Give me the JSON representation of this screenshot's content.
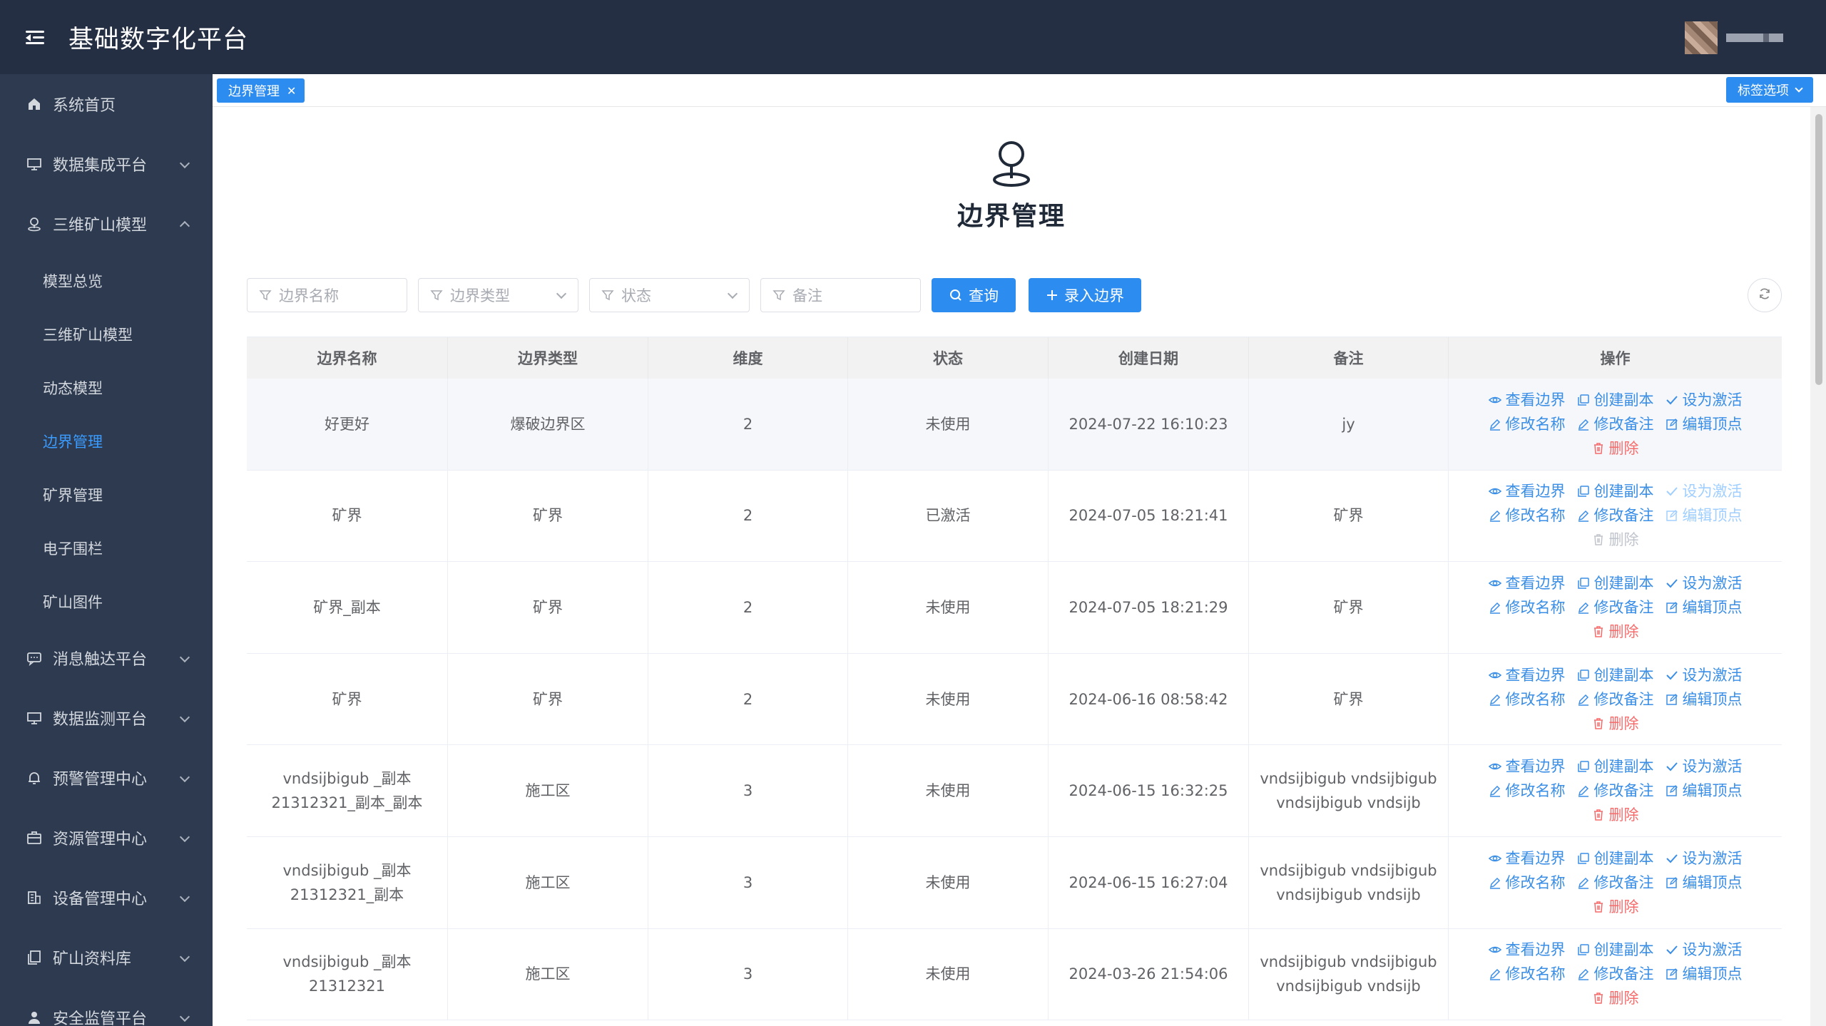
{
  "app": {
    "title": "基础数字化平台"
  },
  "sidebar": {
    "items": [
      {
        "label": "系统首页",
        "icon": "home-icon",
        "expandable": false
      },
      {
        "label": "数据集成平台",
        "icon": "monitor-icon",
        "expandable": true
      },
      {
        "label": "三维矿山模型",
        "icon": "location-pin-icon",
        "expandable": true,
        "expanded": true,
        "children": [
          "模型总览",
          "三维矿山模型",
          "动态模型",
          "边界管理",
          "矿界管理",
          "电子围栏",
          "矿山图件"
        ],
        "active_child": "边界管理"
      },
      {
        "label": "消息触达平台",
        "icon": "chat-icon",
        "expandable": true
      },
      {
        "label": "数据监测平台",
        "icon": "monitor-icon",
        "expandable": true
      },
      {
        "label": "预警管理中心",
        "icon": "bell-icon",
        "expandable": true
      },
      {
        "label": "资源管理中心",
        "icon": "briefcase-icon",
        "expandable": true
      },
      {
        "label": "设备管理中心",
        "icon": "building-icon",
        "expandable": true
      },
      {
        "label": "矿山资料库",
        "icon": "copy-icon",
        "expandable": true
      },
      {
        "label": "安全监管平台",
        "icon": "user-icon",
        "expandable": true
      }
    ]
  },
  "tabs": {
    "active": "边界管理",
    "options_label": "标签选项"
  },
  "page": {
    "title": "边界管理",
    "icon": "location-pin-icon"
  },
  "filters": {
    "name_placeholder": "边界名称",
    "type_placeholder": "边界类型",
    "status_placeholder": "状态",
    "remark_placeholder": "备注",
    "query_label": "查询",
    "add_label": "录入边界"
  },
  "table": {
    "columns": [
      "边界名称",
      "边界类型",
      "维度",
      "状态",
      "创建日期",
      "备注",
      "操作"
    ],
    "rows": [
      {
        "name": "好更好",
        "type": "爆破边界区",
        "dim": "2",
        "status": "未使用",
        "date": "2024-07-22 16:10:23",
        "remark": "jy",
        "active": false
      },
      {
        "name": "矿界",
        "type": "矿界",
        "dim": "2",
        "status": "已激活",
        "date": "2024-07-05 18:21:41",
        "remark": "矿界",
        "active": true
      },
      {
        "name": "矿界_副本",
        "type": "矿界",
        "dim": "2",
        "status": "未使用",
        "date": "2024-07-05 18:21:29",
        "remark": "矿界",
        "active": false
      },
      {
        "name": "矿界",
        "type": "矿界",
        "dim": "2",
        "status": "未使用",
        "date": "2024-06-16 08:58:42",
        "remark": "矿界",
        "active": false
      },
      {
        "name": "vndsijbigub _副本 21312321_副本_副本",
        "type": "施工区",
        "dim": "3",
        "status": "未使用",
        "date": "2024-06-15 16:32:25",
        "remark": "vndsijbigub vndsijbigub vndsijbigub vndsijb",
        "active": false
      },
      {
        "name": "vndsijbigub _副本 21312321_副本",
        "type": "施工区",
        "dim": "3",
        "status": "未使用",
        "date": "2024-06-15 16:27:04",
        "remark": "vndsijbigub vndsijbigub vndsijbigub vndsijb",
        "active": false
      },
      {
        "name": "vndsijbigub _副本 21312321",
        "type": "施工区",
        "dim": "3",
        "status": "未使用",
        "date": "2024-03-26 21:54:06",
        "remark": "vndsijbigub vndsijbigub vndsijbigub vndsijb",
        "active": false
      }
    ],
    "actions": {
      "view": "查看边界",
      "copy": "创建副本",
      "activate": "设为激活",
      "rename": "修改名称",
      "edit_remark": "修改备注",
      "edit_vertex": "编辑顶点",
      "delete": "删除"
    }
  },
  "colors": {
    "header_bg": "#252f43",
    "sidebar_bg": "#2d3a4f",
    "primary": "#2d8cf0",
    "active_link": "#3b9cff",
    "danger": "#f56c6c"
  }
}
